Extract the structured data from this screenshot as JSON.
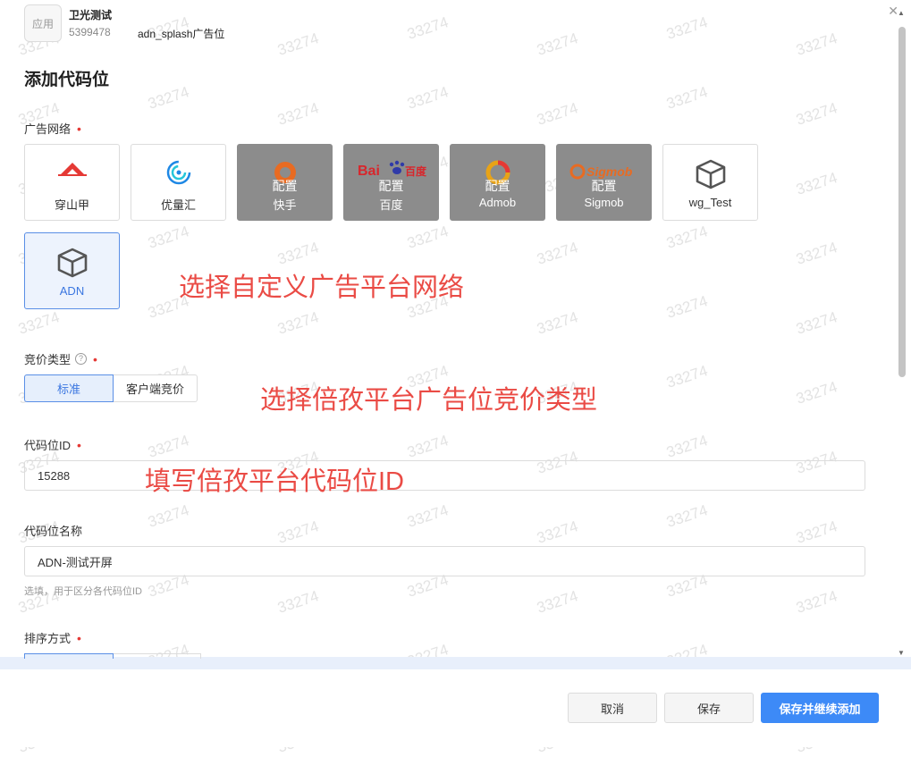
{
  "watermark": "33274",
  "header": {
    "app_icon_text": "应用",
    "app_name": "卫光测试",
    "app_id": "5399478",
    "slot_name": "adn_splash广告位",
    "close_icon": "close-icon"
  },
  "title": "添加代码位",
  "ad_network": {
    "label": "广告网络",
    "required": "•",
    "overlay_text": "配置",
    "cards": [
      {
        "name": "穿山甲",
        "icon": "pangle-logo"
      },
      {
        "name": "优量汇",
        "icon": "ylh-logo"
      },
      {
        "name": "快手",
        "icon": "kuaishou-logo",
        "state": "disabled"
      },
      {
        "name": "百度",
        "icon": "baidu-logo",
        "state": "disabled"
      },
      {
        "name": "Admob",
        "icon": "admob-logo",
        "state": "disabled"
      },
      {
        "name": "Sigmob",
        "icon": "sigmob-logo",
        "logo_text": "Sigmob",
        "state": "disabled"
      },
      {
        "name": "wg_Test",
        "icon": "box-icon"
      },
      {
        "name": "ADN",
        "icon": "box-icon",
        "state": "selected"
      }
    ]
  },
  "bidding": {
    "label": "竞价类型",
    "help_icon": "question-circle-icon",
    "required": "•",
    "options": [
      {
        "label": "标准",
        "selected": true
      },
      {
        "label": "客户端竞价",
        "selected": false
      }
    ]
  },
  "slot_id": {
    "label": "代码位ID",
    "required": "•",
    "value": "15288"
  },
  "slot_name_field": {
    "label": "代码位名称",
    "value": "ADN-测试开屏",
    "hint": "选填，用于区分各代码位ID"
  },
  "sort": {
    "label": "排序方式",
    "required": "•"
  },
  "annotations": {
    "network": "选择自定义广告平台网络",
    "bidding": "选择倍孜平台广告位竞价类型",
    "slot_id": "填写倍孜平台代码位ID"
  },
  "footer": {
    "cancel": "取消",
    "save": "保存",
    "save_continue": "保存并继续添加"
  },
  "colors": {
    "primary": "#3d8af7",
    "selected_bg": "#edf3fd",
    "annotation": "#ea4b45",
    "disabled": "#8c8c8c"
  }
}
